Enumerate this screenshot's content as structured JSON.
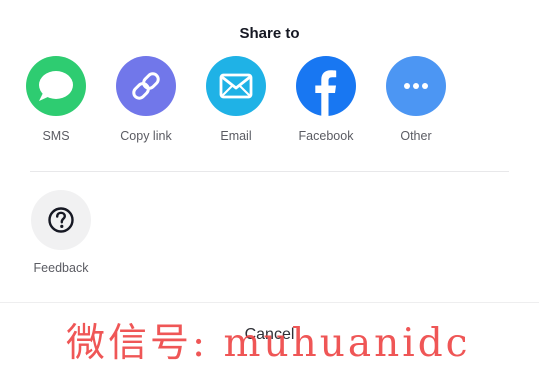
{
  "header": {
    "title": "Share to"
  },
  "share_targets": [
    {
      "label": "SMS",
      "icon": "sms-bubble-icon",
      "color": "#2ecc71"
    },
    {
      "label": "Copy link",
      "icon": "link-icon",
      "color": "#7177ea"
    },
    {
      "label": "Email",
      "icon": "envelope-icon",
      "color": "#1fb2e6"
    },
    {
      "label": "Facebook",
      "icon": "facebook-icon",
      "color": "#1877f2"
    },
    {
      "label": "Other",
      "icon": "more-dots-icon",
      "color": "#4c96f3"
    }
  ],
  "secondary_actions": [
    {
      "label": "Feedback",
      "icon": "question-mark-icon",
      "color": "#f1f1f2"
    }
  ],
  "footer": {
    "cancel_label": "Cancel"
  },
  "watermark": {
    "text": "微信号: muhuanidc",
    "color": "#ee4848"
  }
}
